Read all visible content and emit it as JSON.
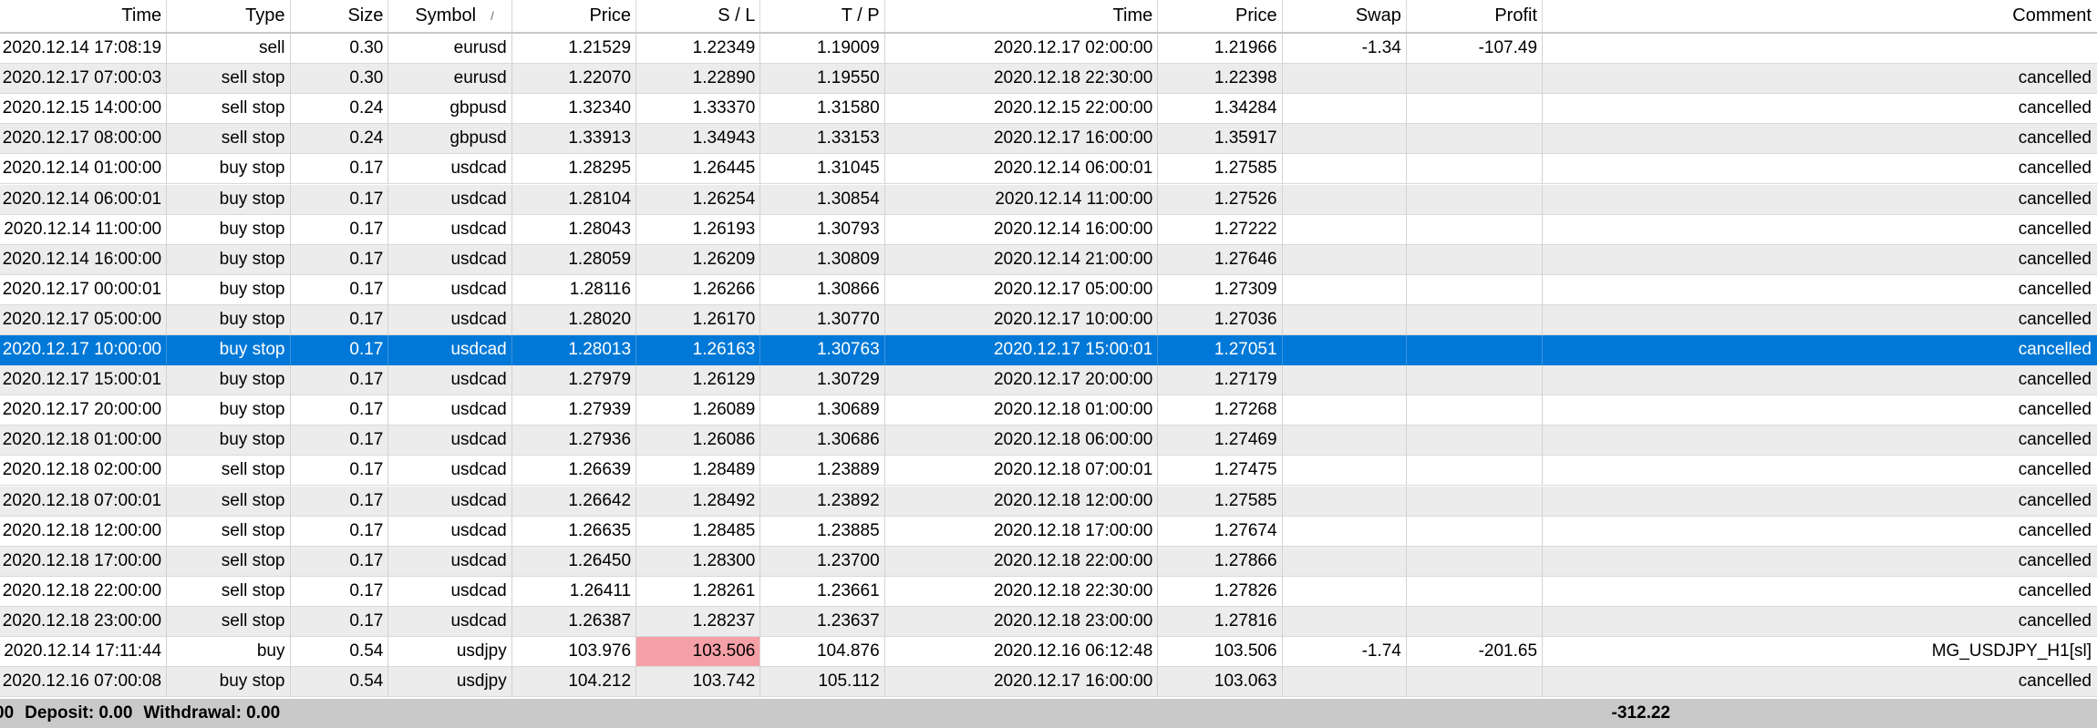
{
  "columns": [
    "Time",
    "Type",
    "Size",
    "Symbol",
    "Price",
    "S / L",
    "T / P",
    "Time",
    "Price",
    "Swap",
    "Profit",
    "Comment"
  ],
  "sort_column": "Symbol",
  "rows": [
    [
      "2020.12.14 17:08:19",
      "sell",
      "0.30",
      "eurusd",
      "1.21529",
      "1.22349",
      "1.19009",
      "2020.12.17 02:00:00",
      "1.21966",
      "-1.34",
      "-107.49",
      ""
    ],
    [
      "2020.12.17 07:00:03",
      "sell stop",
      "0.30",
      "eurusd",
      "1.22070",
      "1.22890",
      "1.19550",
      "2020.12.18 22:30:00",
      "1.22398",
      "",
      "",
      "cancelled"
    ],
    [
      "2020.12.15 14:00:00",
      "sell stop",
      "0.24",
      "gbpusd",
      "1.32340",
      "1.33370",
      "1.31580",
      "2020.12.15 22:00:00",
      "1.34284",
      "",
      "",
      "cancelled"
    ],
    [
      "2020.12.17 08:00:00",
      "sell stop",
      "0.24",
      "gbpusd",
      "1.33913",
      "1.34943",
      "1.33153",
      "2020.12.17 16:00:00",
      "1.35917",
      "",
      "",
      "cancelled"
    ],
    [
      "2020.12.14 01:00:00",
      "buy stop",
      "0.17",
      "usdcad",
      "1.28295",
      "1.26445",
      "1.31045",
      "2020.12.14 06:00:01",
      "1.27585",
      "",
      "",
      "cancelled"
    ],
    [
      "2020.12.14 06:00:01",
      "buy stop",
      "0.17",
      "usdcad",
      "1.28104",
      "1.26254",
      "1.30854",
      "2020.12.14 11:00:00",
      "1.27526",
      "",
      "",
      "cancelled"
    ],
    [
      "2020.12.14 11:00:00",
      "buy stop",
      "0.17",
      "usdcad",
      "1.28043",
      "1.26193",
      "1.30793",
      "2020.12.14 16:00:00",
      "1.27222",
      "",
      "",
      "cancelled"
    ],
    [
      "2020.12.14 16:00:00",
      "buy stop",
      "0.17",
      "usdcad",
      "1.28059",
      "1.26209",
      "1.30809",
      "2020.12.14 21:00:00",
      "1.27646",
      "",
      "",
      "cancelled"
    ],
    [
      "2020.12.17 00:00:01",
      "buy stop",
      "0.17",
      "usdcad",
      "1.28116",
      "1.26266",
      "1.30866",
      "2020.12.17 05:00:00",
      "1.27309",
      "",
      "",
      "cancelled"
    ],
    [
      "2020.12.17 05:00:00",
      "buy stop",
      "0.17",
      "usdcad",
      "1.28020",
      "1.26170",
      "1.30770",
      "2020.12.17 10:00:00",
      "1.27036",
      "",
      "",
      "cancelled"
    ],
    [
      "2020.12.17 10:00:00",
      "buy stop",
      "0.17",
      "usdcad",
      "1.28013",
      "1.26163",
      "1.30763",
      "2020.12.17 15:00:01",
      "1.27051",
      "",
      "",
      "cancelled"
    ],
    [
      "2020.12.17 15:00:01",
      "buy stop",
      "0.17",
      "usdcad",
      "1.27979",
      "1.26129",
      "1.30729",
      "2020.12.17 20:00:00",
      "1.27179",
      "",
      "",
      "cancelled"
    ],
    [
      "2020.12.17 20:00:00",
      "buy stop",
      "0.17",
      "usdcad",
      "1.27939",
      "1.26089",
      "1.30689",
      "2020.12.18 01:00:00",
      "1.27268",
      "",
      "",
      "cancelled"
    ],
    [
      "2020.12.18 01:00:00",
      "buy stop",
      "0.17",
      "usdcad",
      "1.27936",
      "1.26086",
      "1.30686",
      "2020.12.18 06:00:00",
      "1.27469",
      "",
      "",
      "cancelled"
    ],
    [
      "2020.12.18 02:00:00",
      "sell stop",
      "0.17",
      "usdcad",
      "1.26639",
      "1.28489",
      "1.23889",
      "2020.12.18 07:00:01",
      "1.27475",
      "",
      "",
      "cancelled"
    ],
    [
      "2020.12.18 07:00:01",
      "sell stop",
      "0.17",
      "usdcad",
      "1.26642",
      "1.28492",
      "1.23892",
      "2020.12.18 12:00:00",
      "1.27585",
      "",
      "",
      "cancelled"
    ],
    [
      "2020.12.18 12:00:00",
      "sell stop",
      "0.17",
      "usdcad",
      "1.26635",
      "1.28485",
      "1.23885",
      "2020.12.18 17:00:00",
      "1.27674",
      "",
      "",
      "cancelled"
    ],
    [
      "2020.12.18 17:00:00",
      "sell stop",
      "0.17",
      "usdcad",
      "1.26450",
      "1.28300",
      "1.23700",
      "2020.12.18 22:00:00",
      "1.27866",
      "",
      "",
      "cancelled"
    ],
    [
      "2020.12.18 22:00:00",
      "sell stop",
      "0.17",
      "usdcad",
      "1.26411",
      "1.28261",
      "1.23661",
      "2020.12.18 22:30:00",
      "1.27826",
      "",
      "",
      "cancelled"
    ],
    [
      "2020.12.18 23:00:00",
      "sell stop",
      "0.17",
      "usdcad",
      "1.26387",
      "1.28237",
      "1.23637",
      "2020.12.18 23:00:00",
      "1.27816",
      "",
      "",
      "cancelled"
    ],
    [
      "2020.12.14 17:11:44",
      "buy",
      "0.54",
      "usdjpy",
      "103.976",
      "103.506",
      "104.876",
      "2020.12.16 06:12:48",
      "103.506",
      "-1.74",
      "-201.65",
      "MG_USDJPY_H1[sl]"
    ],
    [
      "2020.12.16 07:00:08",
      "buy stop",
      "0.54",
      "usdjpy",
      "104.212",
      "103.742",
      "105.112",
      "2020.12.17 16:00:00",
      "103.063",
      "",
      "",
      "cancelled"
    ]
  ],
  "selected_row": 10,
  "sl_hit_row": 20,
  "summary": {
    "fragment": "00",
    "deposit": "Deposit: 0.00",
    "withdrawal": "Withdrawal: 0.00",
    "total_profit": "-312.22"
  },
  "colors": {
    "selected_bg": "#0078d7",
    "alt_row_bg": "#ececec",
    "sl_hit_bg": "#f5a0a6",
    "summary_bg": "#c9c9c9"
  }
}
